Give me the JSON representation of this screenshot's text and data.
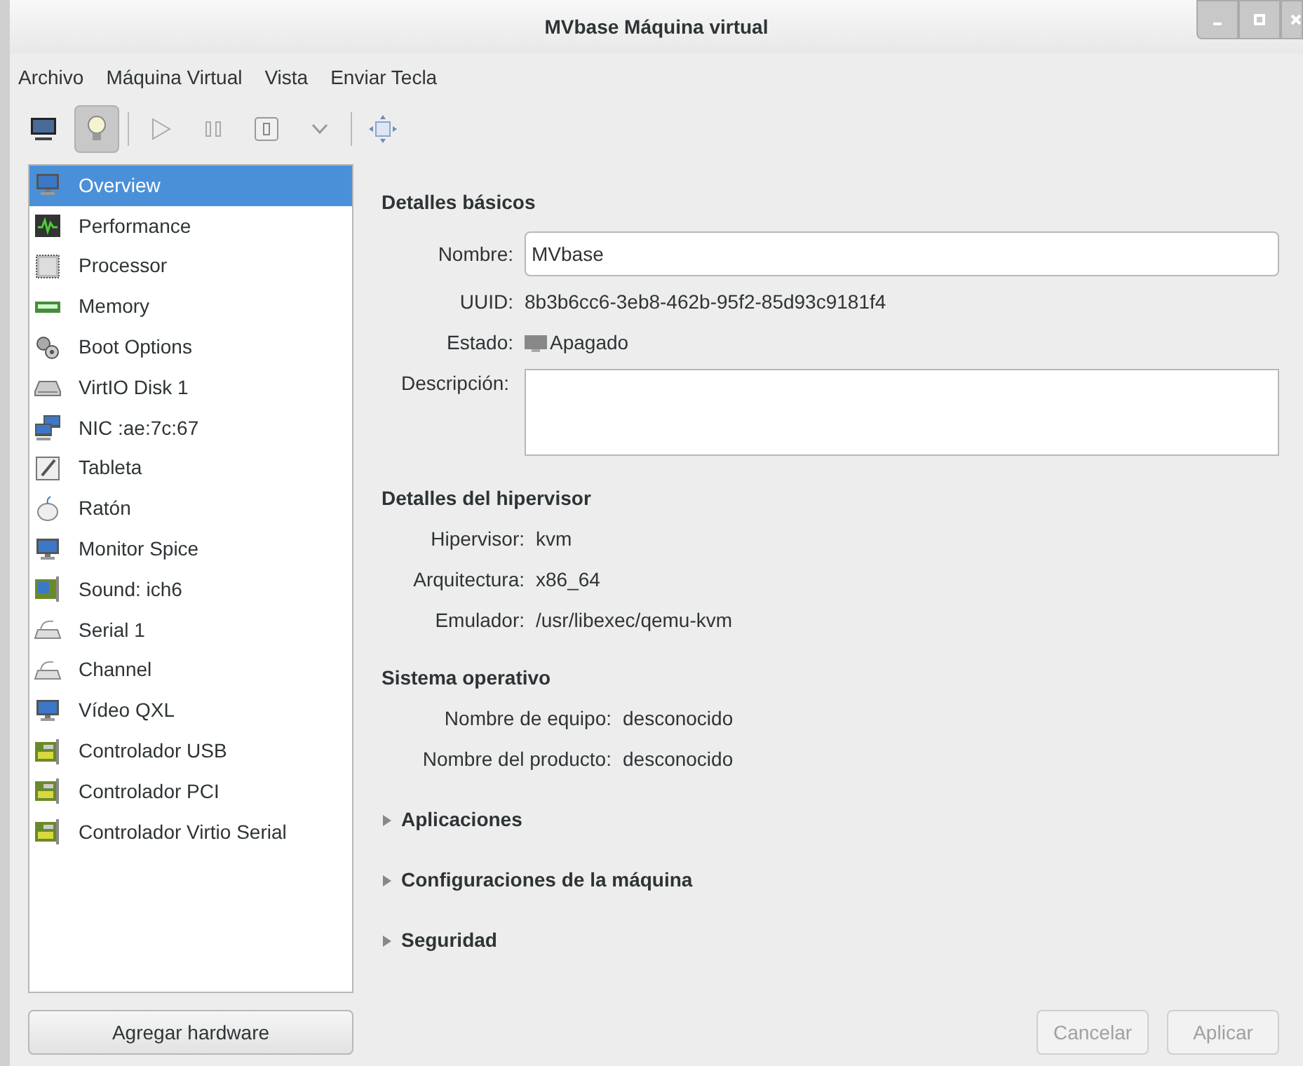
{
  "window": {
    "title": "MVbase Máquina virtual"
  },
  "menu": [
    "Archivo",
    "Máquina Virtual",
    "Vista",
    "Enviar Tecla"
  ],
  "toolbar": [
    {
      "kind": "console",
      "selected": false
    },
    {
      "kind": "details",
      "selected": true
    },
    {
      "kind": "separator"
    },
    {
      "kind": "run",
      "selected": false
    },
    {
      "kind": "pause",
      "selected": false
    },
    {
      "kind": "shutdown",
      "selected": false
    },
    {
      "kind": "dropdown",
      "selected": false
    },
    {
      "kind": "separator"
    },
    {
      "kind": "fullscreen",
      "selected": false
    }
  ],
  "sidebar": {
    "items": [
      {
        "label": "Overview",
        "kind": "monitor",
        "selected": true
      },
      {
        "label": "Performance",
        "kind": "performance",
        "selected": false
      },
      {
        "label": "Processor",
        "kind": "chip",
        "selected": false
      },
      {
        "label": "Memory",
        "kind": "memory",
        "selected": false
      },
      {
        "label": "Boot Options",
        "kind": "gears",
        "selected": false
      },
      {
        "label": "VirtIO Disk 1",
        "kind": "disk",
        "selected": false
      },
      {
        "label": "NIC :ae:7c:67",
        "kind": "network",
        "selected": false
      },
      {
        "label": "Tableta",
        "kind": "tablet",
        "selected": false
      },
      {
        "label": "Ratón",
        "kind": "mouse",
        "selected": false
      },
      {
        "label": "Monitor Spice",
        "kind": "monitor",
        "selected": false
      },
      {
        "label": "Sound: ich6",
        "kind": "sound",
        "selected": false
      },
      {
        "label": "Serial 1",
        "kind": "serial",
        "selected": false
      },
      {
        "label": "Channel",
        "kind": "serial",
        "selected": false
      },
      {
        "label": "Vídeo QXL",
        "kind": "monitor",
        "selected": false
      },
      {
        "label": "Controlador USB",
        "kind": "card",
        "selected": false
      },
      {
        "label": "Controlador PCI",
        "kind": "card",
        "selected": false
      },
      {
        "label": "Controlador Virtio Serial",
        "kind": "card",
        "selected": false
      }
    ],
    "add_button": "Agregar hardware"
  },
  "basic": {
    "heading": "Detalles básicos",
    "name_label": "Nombre:",
    "name_value": "MVbase",
    "uuid_label": "UUID:",
    "uuid": "8b3b6cc6-3eb8-462b-95f2-85d93c9181f4",
    "state_label": "Estado:",
    "state": "Apagado",
    "description_label": "Descripción:"
  },
  "hypervisor": {
    "heading": "Detalles del hipervisor",
    "rows": [
      {
        "label": "Hipervisor:",
        "value": "kvm"
      },
      {
        "label": "Arquitectura:",
        "value": "x86_64"
      },
      {
        "label": "Emulador:",
        "value": "/usr/libexec/qemu-kvm"
      }
    ]
  },
  "os": {
    "heading": "Sistema operativo",
    "rows": [
      {
        "label": "Nombre de equipo:",
        "value": "desconocido"
      },
      {
        "label": "Nombre del producto:",
        "value": "desconocido"
      }
    ]
  },
  "expanders": [
    {
      "label": "Aplicaciones",
      "expanded": false
    },
    {
      "label": "Configuraciones de la máquina",
      "expanded": false
    },
    {
      "label": "Seguridad",
      "expanded": false
    }
  ],
  "buttons": [
    {
      "label": "Cancelar",
      "disabled": true
    },
    {
      "label": "Aplicar",
      "disabled": true
    }
  ]
}
